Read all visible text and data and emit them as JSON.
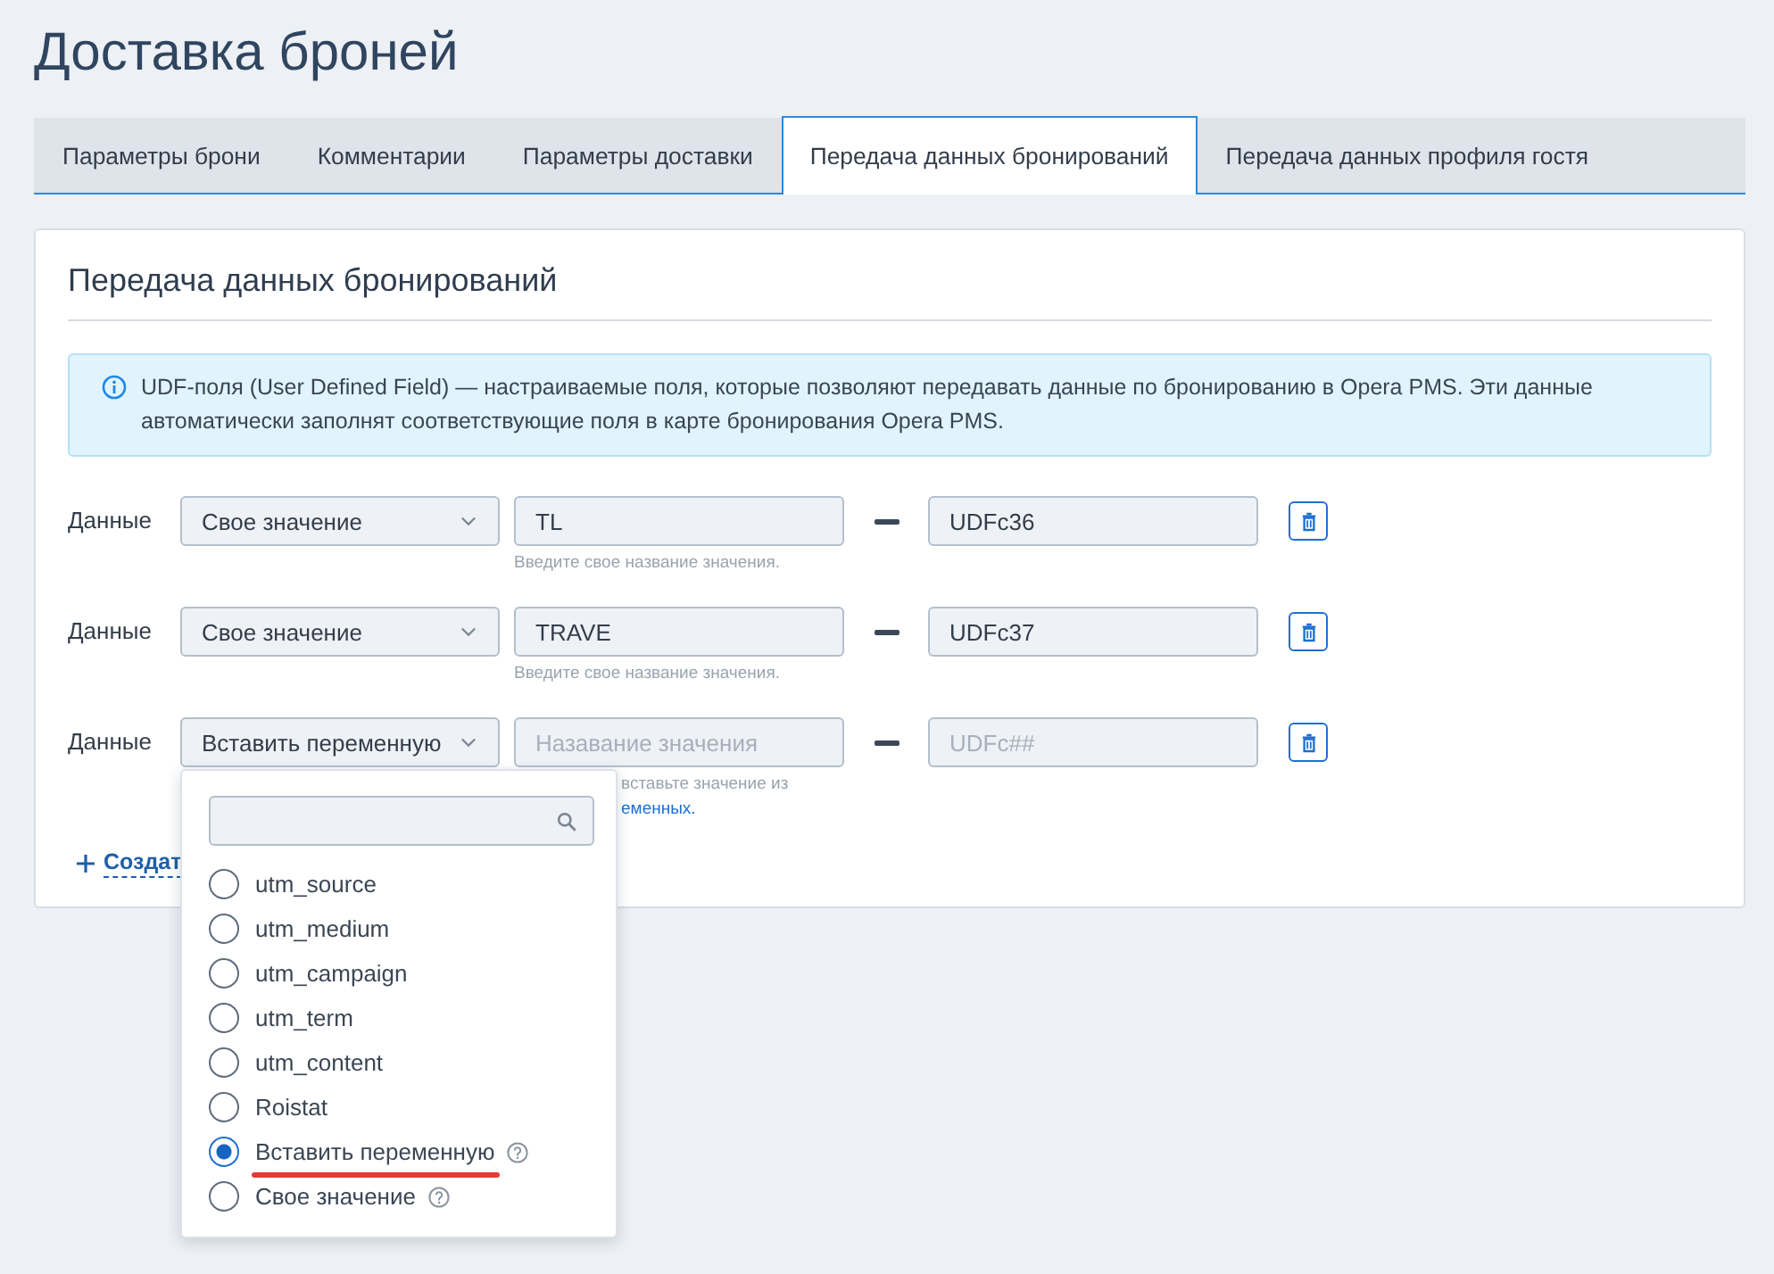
{
  "page": {
    "title": "Доставка броней"
  },
  "tabs": [
    {
      "label": "Параметры брони",
      "selected": false
    },
    {
      "label": "Комментарии",
      "selected": false
    },
    {
      "label": "Параметры доставки",
      "selected": false
    },
    {
      "label": "Передача данных бронирований",
      "selected": true
    },
    {
      "label": "Передача данных профиля гостя",
      "selected": false
    }
  ],
  "panel": {
    "title": "Передача данных бронирований",
    "info": "UDF-поля (User Defined Field) — настраиваемые поля, которые позволяют передавать данные по бронированию в Opera PMS. Эти данные автоматически заполнят соответствующие поля в карте бронирования Opera PMS."
  },
  "mappings": [
    {
      "label": "Данные",
      "source": "Свое значение",
      "value": "TL",
      "udf": "UDFc36",
      "hint": "Введите свое название значения."
    },
    {
      "label": "Данные",
      "source": "Свое значение",
      "value": "TRAVE",
      "udf": "UDFc37",
      "hint": "Введите свое название значения."
    },
    {
      "label": "Данные",
      "source": "Вставить переменную",
      "value_placeholder": "Назавание значения",
      "udf_placeholder": "UDFc##",
      "hint": "вставьте значение из",
      "hint_link": "еменных.",
      "menu": {
        "options": [
          {
            "label": "utm_source",
            "selected": false,
            "help": false,
            "underlined": false
          },
          {
            "label": "utm_medium",
            "selected": false,
            "help": false,
            "underlined": false
          },
          {
            "label": "utm_campaign",
            "selected": false,
            "help": false,
            "underlined": false
          },
          {
            "label": "utm_term",
            "selected": false,
            "help": false,
            "underlined": false
          },
          {
            "label": "utm_content",
            "selected": false,
            "help": false,
            "underlined": false
          },
          {
            "label": "Roistat",
            "selected": false,
            "help": false,
            "underlined": false
          },
          {
            "label": "Вставить переменную",
            "selected": true,
            "help": true,
            "underlined": true
          },
          {
            "label": "Свое значение",
            "selected": false,
            "help": true,
            "underlined": false
          }
        ]
      }
    }
  ],
  "add_link": "Создат"
}
